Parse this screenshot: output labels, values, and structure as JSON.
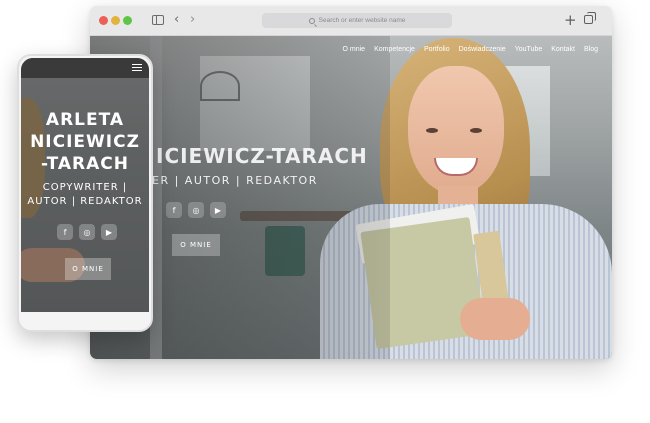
{
  "browser": {
    "address_placeholder": "Search or enter website name",
    "icons": [
      "sidebar-icon",
      "back-icon",
      "forward-icon",
      "search-icon",
      "plus-icon",
      "tabs-icon"
    ]
  },
  "site": {
    "nav": [
      "O mnie",
      "Kompetencje",
      "Portfolio",
      "Doświadczenie",
      "YouTube",
      "Kontakt",
      "Blog"
    ],
    "hero_name_desktop": "ICIEWICZ-TARACH",
    "hero_subtitle_desktop": "ER | AUTOR | REDAKTOR",
    "cta_desktop": "O MNIE",
    "social": [
      {
        "name": "facebook-icon",
        "glyph": "f"
      },
      {
        "name": "instagram-icon",
        "glyph": "◎"
      },
      {
        "name": "youtube-icon",
        "glyph": "▶"
      }
    ]
  },
  "phone": {
    "name_line1": "ARLETA",
    "name_line2": "NICIEWICZ",
    "name_line3": "-TARACH",
    "subtitle_line1": "COPYWRITER |",
    "subtitle_line2": "AUTOR | REDAKTOR",
    "cta": "O MNIE"
  },
  "colors": {
    "close": "#ec5f57",
    "minimize": "#e3b33d",
    "zoom": "#5ec548",
    "chrome": "#e8e8e9"
  }
}
